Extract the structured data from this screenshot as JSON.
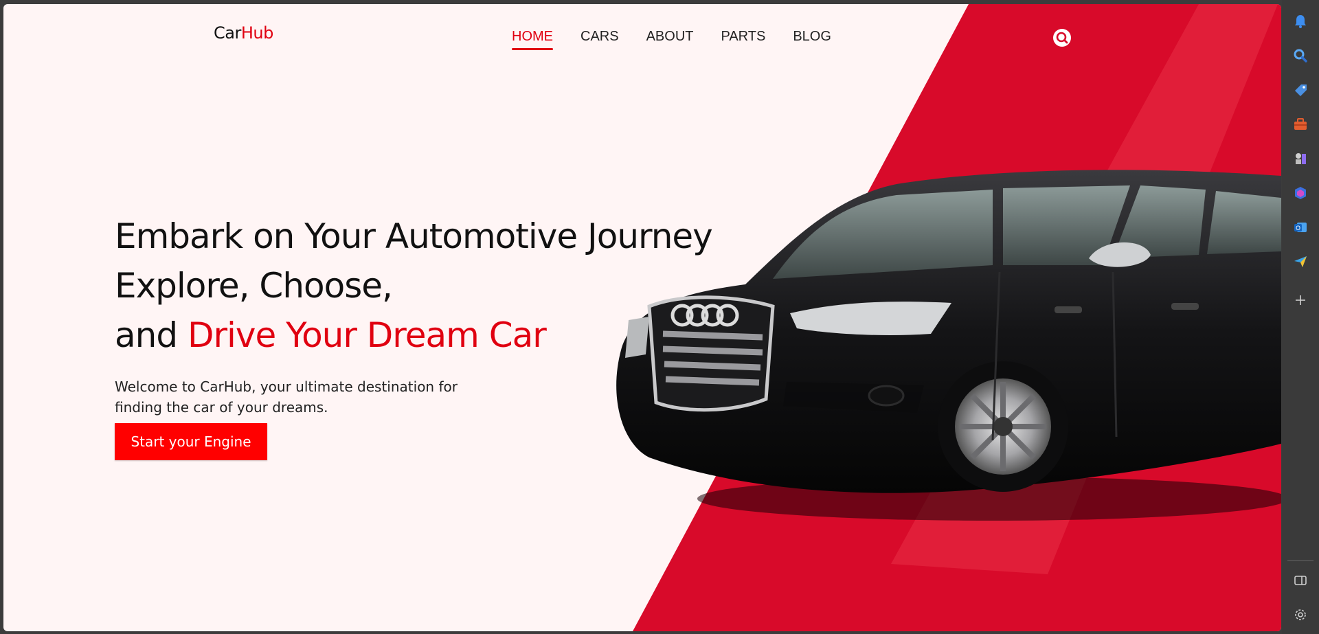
{
  "site": {
    "logo_part1": "Car",
    "logo_part2": "Hub",
    "nav": [
      {
        "label": "HOME",
        "active": true
      },
      {
        "label": "CARS",
        "active": false
      },
      {
        "label": "ABOUT",
        "active": false
      },
      {
        "label": "PARTS",
        "active": false
      },
      {
        "label": "BLOG",
        "active": false
      }
    ],
    "search_icon": "search-icon"
  },
  "hero": {
    "line1": "Embark on Your Automotive Journey",
    "line2": "Explore, Choose,",
    "line3_prefix": "and ",
    "line3_accent": "Drive Your Dream Car",
    "description": "Welcome to CarHub, your ultimate destination for finding the car of your dreams.",
    "cta_label": "Start your Engine",
    "image": "black-sedan-car"
  },
  "colors": {
    "accent": "#e00010",
    "background": "#fff5f5",
    "panel_red": "#d80a2a"
  },
  "sidebar": {
    "icons": [
      "bell-icon",
      "search-icon",
      "tag-icon",
      "briefcase-icon",
      "chess-icon",
      "copilot-icon",
      "outlook-icon",
      "send-icon",
      "plus-icon"
    ],
    "bottom_icons": [
      "sidebar-toggle-icon",
      "settings-icon"
    ]
  }
}
